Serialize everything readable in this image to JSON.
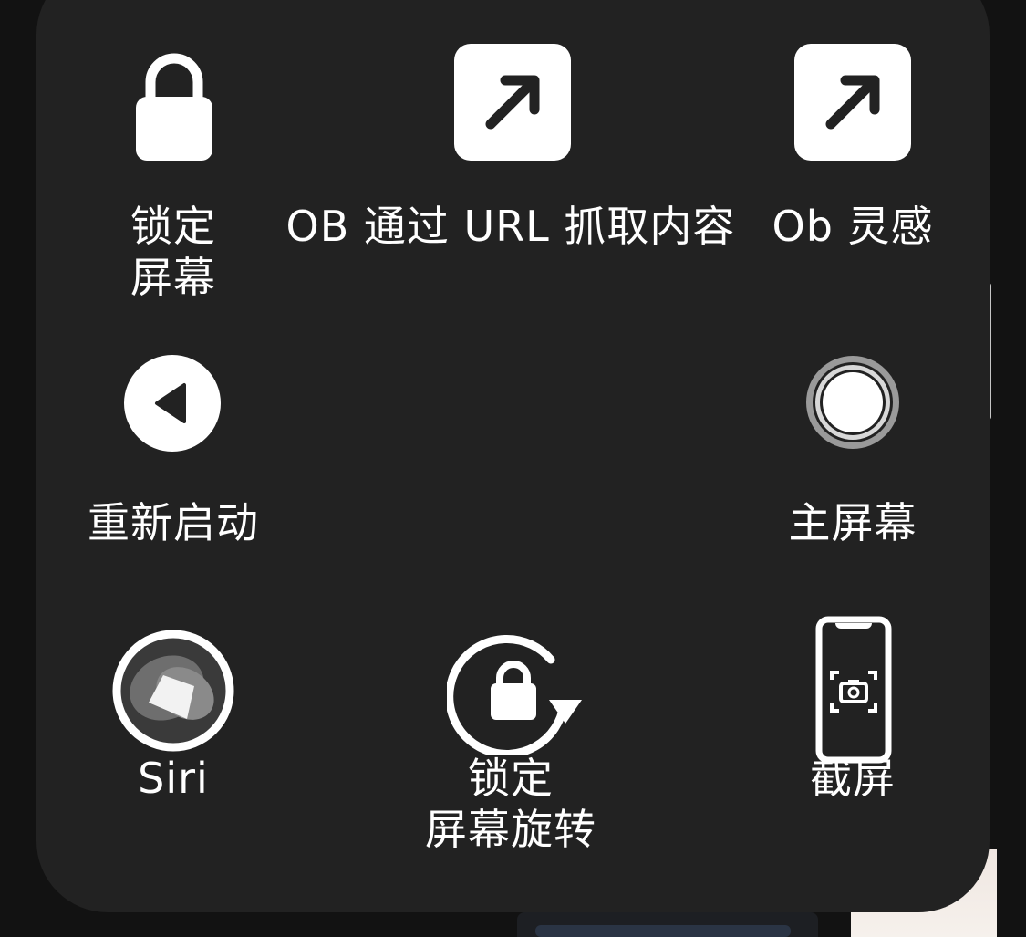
{
  "menu": {
    "items": [
      {
        "id": "lock-screen",
        "label": "锁定\n屏幕",
        "icon": "lock-icon"
      },
      {
        "id": "ob-url",
        "label": "OB 通过 URL 抓取内容",
        "icon": "arrow-up-right-icon"
      },
      {
        "id": "ob-inspiration",
        "label": "Ob 灵感",
        "icon": "arrow-up-right-icon"
      },
      {
        "id": "restart",
        "label": "重新启动",
        "icon": "back-triangle-icon"
      },
      {
        "id": "home",
        "label": "主屏幕",
        "icon": "home-button-icon"
      },
      {
        "id": "siri",
        "label": "Siri",
        "icon": "siri-icon"
      },
      {
        "id": "lock-rotation",
        "label": "锁定\n屏幕旋转",
        "icon": "rotation-lock-icon"
      },
      {
        "id": "screenshot",
        "label": "截屏",
        "icon": "screenshot-phone-icon"
      }
    ]
  },
  "colors": {
    "panel": "#222222",
    "icon": "#ffffff",
    "text": "#ffffff"
  }
}
